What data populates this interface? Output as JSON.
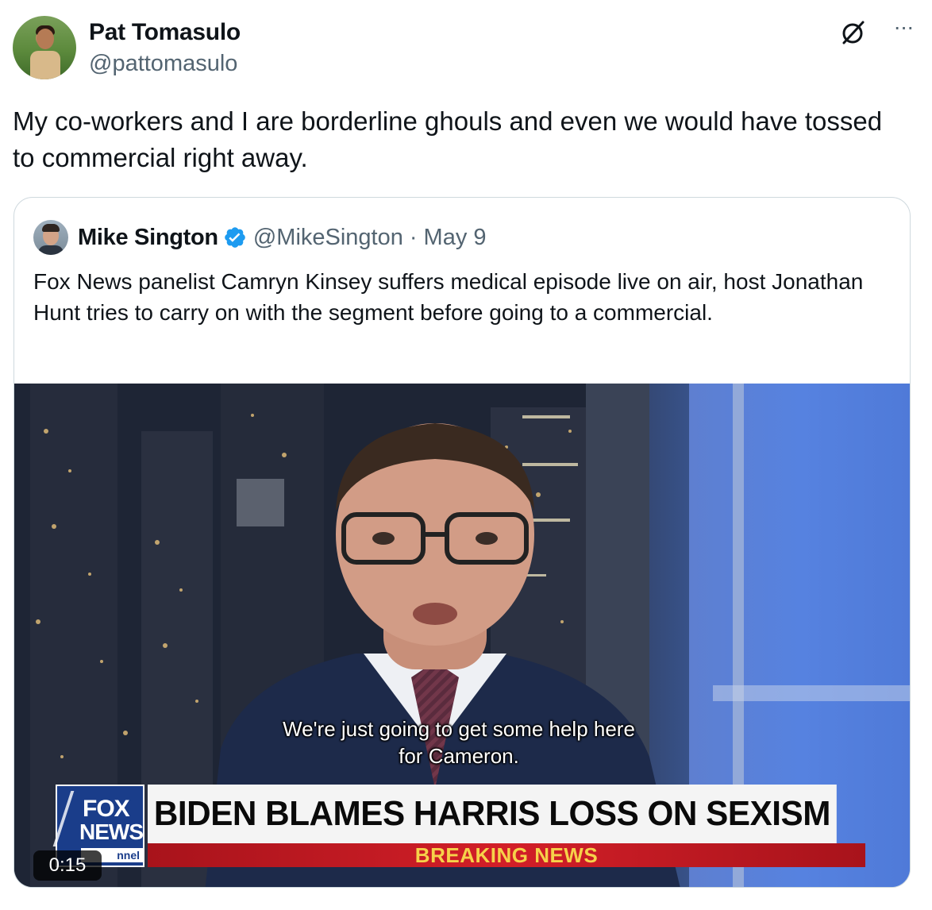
{
  "tweet": {
    "author_name": "Pat Tomasulo",
    "author_handle": "@pattomasulo",
    "text": "My co-workers and I are borderline ghouls and even we would have tossed to commercial right away.",
    "more_icon": "more-icon",
    "grok_icon": "grok-icon"
  },
  "quoted": {
    "author_name": "Mike Sington",
    "author_handle": "@MikeSington",
    "separator": "·",
    "date": "May 9",
    "verified_icon": "verified-badge-icon",
    "text": "Fox News panelist Camryn Kinsey suffers medical episode live on air, host Jonathan Hunt tries to carry on with the segment before going to a commercial.",
    "video": {
      "caption_line1": "We're just going to get some help here",
      "caption_line2": "for Cameron.",
      "headline": "BIDEN BLAMES HARRIS LOSS ON SEXISM",
      "breaking": "BREAKING NEWS",
      "logo_top": "FOX",
      "logo_mid": "NEWS",
      "logo_bottom": "nnel",
      "duration": "0:15"
    }
  },
  "colors": {
    "text_primary": "#0f1419",
    "text_secondary": "#536471",
    "border": "#cfd9de",
    "verified_blue": "#1d9bf0"
  }
}
